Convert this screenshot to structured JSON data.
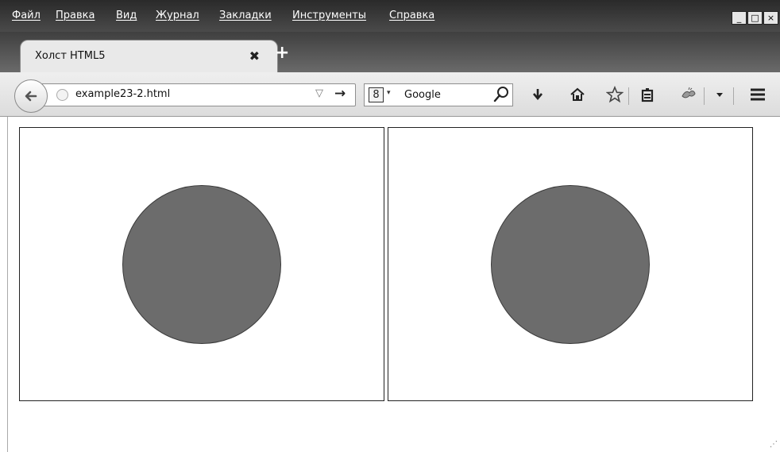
{
  "menu": {
    "items": [
      "Файл",
      "Правка",
      "Вид",
      "Журнал",
      "Закладки",
      "Инструменты",
      "Справка"
    ]
  },
  "window_controls": {
    "minimize": "_",
    "maximize": "□",
    "close": "×"
  },
  "tab": {
    "title": "Холст HTML5",
    "close": "✖",
    "new_tab": "+"
  },
  "navbar": {
    "url": "example23-2.html",
    "dropdown": "▽",
    "go": "→",
    "search_engine_letter": "8",
    "search_caret": "▾",
    "search_text": "Google"
  },
  "icons": {
    "back": "back-arrow-icon",
    "download": "download-icon",
    "home": "home-icon",
    "bookmark": "star-icon",
    "reading_list": "clipboard-icon",
    "addon": "addon-icon",
    "menu": "hamburger-menu-icon"
  },
  "colors": {
    "circle_fill": "#6c6c6c",
    "circle_stroke": "#3a3a3a",
    "menubar": "#333333"
  },
  "content": {
    "resize_grip": "⋰"
  }
}
